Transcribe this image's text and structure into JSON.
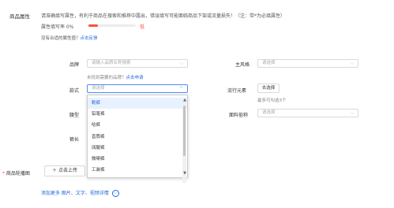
{
  "section": {
    "title": "商品属性",
    "notice": "请准确填写属性，有利于商品在搜索和推荐中露出，错误填写可能面临商品下架或流量损失！（注：带*为必填属性）",
    "fill_rate_label": "属性填写率 0%",
    "fill_rate_value": 0,
    "fill_rate_status": "低",
    "no_attr_text": "没有合适的属性值？",
    "feedback_link": "点击反馈"
  },
  "fields": {
    "brand": {
      "label": "品牌",
      "placeholder": "请输入品牌名称搜索",
      "hint": "未找到需要的品牌？",
      "hint_link": "点击申请"
    },
    "style": {
      "label": "主风格",
      "placeholder": "请选择"
    },
    "kuanshi": {
      "label": "款式",
      "placeholder": "请选择"
    },
    "trend": {
      "label": "流行元素",
      "button": "去选择",
      "hint": "最多可勾选3个"
    },
    "waist": {
      "label": "腰型"
    },
    "fabric": {
      "label": "面料俗称",
      "placeholder": "请选择"
    },
    "length": {
      "label": "裤长"
    }
  },
  "dropdown": {
    "options": [
      "靴裤",
      "铅笔裤",
      "哈裤",
      "直筒裤",
      "阔腿裤",
      "微喇裤",
      "工装裤"
    ],
    "highlighted_index": 0
  },
  "images": {
    "label": "商品轮播图",
    "required_mark": "*",
    "upload_button": "点击上传",
    "more_link": "添加更多 图片、文字、视频详情"
  },
  "colors": {
    "accent": "#1e6be0",
    "danger": "#ff4d3c",
    "focus": "#4b8df8"
  }
}
